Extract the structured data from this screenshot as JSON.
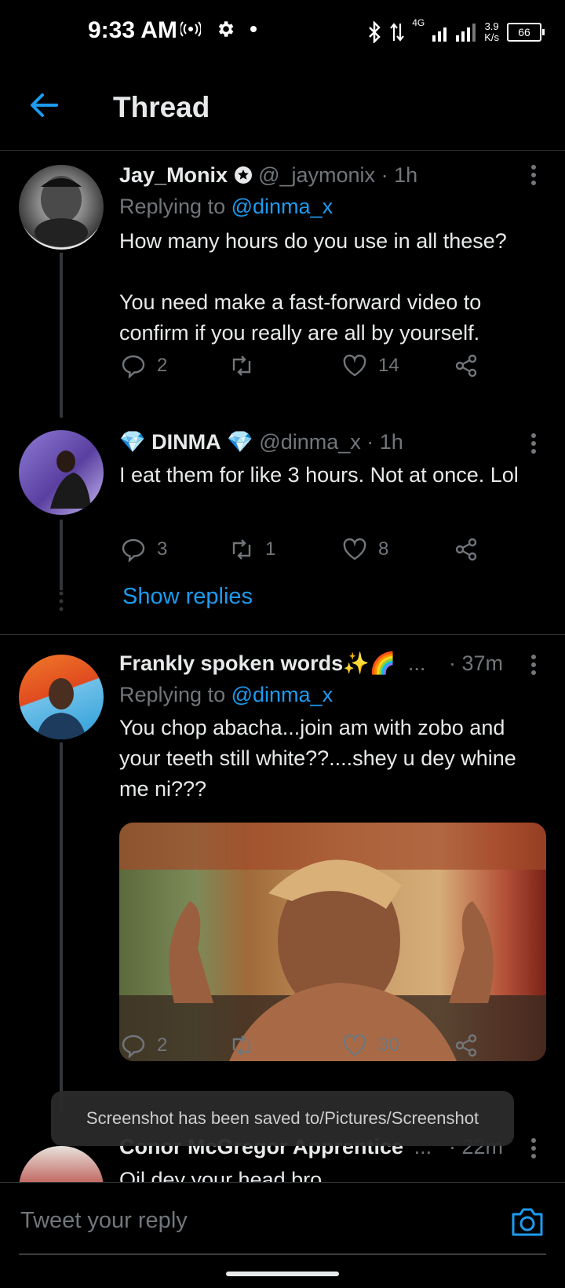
{
  "status_bar": {
    "time": "9:33 AM",
    "network": "4G",
    "net_speed_value": "3.9",
    "net_speed_unit": "K/s",
    "battery": "66",
    "icons": [
      "hotspot-icon",
      "gear-icon",
      "dot-icon",
      "bluetooth-icon",
      "data-arrows-icon",
      "signal-icon"
    ]
  },
  "header": {
    "title": "Thread",
    "back_icon": "back-arrow-icon"
  },
  "tweets": [
    {
      "name": "Jay_Monix",
      "handle": "@_jaymonix",
      "time": "· 1h",
      "replying_prefix": "Replying to",
      "replying_to": "@dinma_x",
      "body": "How many hours do you use in all these?\n\nYou need make a fast-forward video to confirm if you really are all by yourself.",
      "replies": "2",
      "retweets": "",
      "likes": "14"
    },
    {
      "name_prefix_emoji": "💎",
      "name": "DINMA",
      "name_suffix_emoji": "💎",
      "handle": "@dinma_x",
      "time": "· 1h",
      "body": "I eat them for like 3 hours. Not at once. Lol",
      "replies": "3",
      "retweets": "1",
      "likes": "8",
      "show_replies": "Show replies"
    },
    {
      "name": "Frankly spoken words",
      "name_suffix_emoji": "✨🌈",
      "name_ellipsis": "...",
      "time": "· 37m",
      "replying_prefix": "Replying to",
      "replying_to": "@dinma_x",
      "body": "You chop abacha...join am with zobo and your teeth still white??....shey u dey whine me ni???",
      "replies": "2",
      "retweets": "",
      "likes": "30"
    },
    {
      "name": "Conor McGregor Apprentice",
      "name_ellipsis": "...",
      "time": "· 22m",
      "body": "Oil dey your head bro"
    }
  ],
  "toast": {
    "text": "Screenshot has been saved to/Pictures/Screenshot"
  },
  "reply_bar": {
    "placeholder": "Tweet your reply",
    "camera_icon": "camera-icon"
  },
  "colors": {
    "accent": "#1d9bf0",
    "muted": "#71767b",
    "text": "#e7e9ea",
    "background": "#000000"
  }
}
